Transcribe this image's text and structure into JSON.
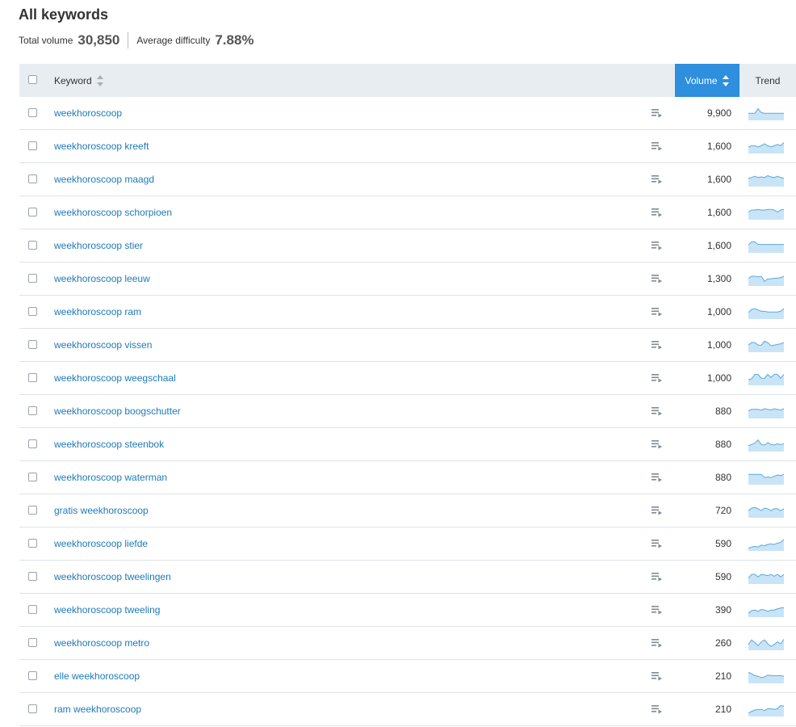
{
  "header": {
    "title": "All keywords",
    "total_volume_label": "Total volume",
    "total_volume_value": "30,850",
    "avg_difficulty_label": "Average difficulty",
    "avg_difficulty_value": "7.88%"
  },
  "table": {
    "columns": {
      "keyword": "Keyword",
      "volume": "Volume",
      "trend": "Trend"
    },
    "sort_column": "Volume",
    "accent_color": "#2d8fdd",
    "rows": [
      {
        "keyword": "weekhoroscoop",
        "volume": "9,900",
        "trend": [
          0.55,
          0.55,
          0.55,
          0.9,
          0.6,
          0.55,
          0.55,
          0.55,
          0.55,
          0.55,
          0.55,
          0.55
        ]
      },
      {
        "keyword": "weekhoroscoop kreeft",
        "volume": "1,600",
        "trend": [
          0.5,
          0.6,
          0.6,
          0.5,
          0.6,
          0.75,
          0.6,
          0.5,
          0.6,
          0.7,
          0.6,
          0.85
        ]
      },
      {
        "keyword": "weekhoroscoop maagd",
        "volume": "1,600",
        "trend": [
          0.65,
          0.7,
          0.8,
          0.7,
          0.75,
          0.7,
          0.85,
          0.75,
          0.7,
          0.8,
          0.7,
          0.65
        ]
      },
      {
        "keyword": "weekhoroscoop schorpioen",
        "volume": "1,600",
        "trend": [
          0.6,
          0.75,
          0.75,
          0.8,
          0.75,
          0.75,
          0.8,
          0.8,
          0.75,
          0.6,
          0.75,
          0.8
        ]
      },
      {
        "keyword": "weekhoroscoop stier",
        "volume": "1,600",
        "trend": [
          0.6,
          0.85,
          0.85,
          0.65,
          0.65,
          0.65,
          0.65,
          0.65,
          0.65,
          0.65,
          0.65,
          0.65
        ]
      },
      {
        "keyword": "weekhoroscoop leeuw",
        "volume": "1,300",
        "trend": [
          0.6,
          0.75,
          0.75,
          0.7,
          0.75,
          0.35,
          0.55,
          0.55,
          0.6,
          0.6,
          0.65,
          0.75
        ]
      },
      {
        "keyword": "weekhoroscoop ram",
        "volume": "1,000",
        "trend": [
          0.5,
          0.75,
          0.8,
          0.7,
          0.6,
          0.6,
          0.55,
          0.55,
          0.55,
          0.55,
          0.6,
          0.8
        ]
      },
      {
        "keyword": "weekhoroscoop vissen",
        "volume": "1,000",
        "trend": [
          0.55,
          0.75,
          0.75,
          0.55,
          0.55,
          0.85,
          0.75,
          0.5,
          0.55,
          0.6,
          0.65,
          0.75
        ]
      },
      {
        "keyword": "weekhoroscoop weegschaal",
        "volume": "1,000",
        "trend": [
          0.45,
          0.5,
          0.85,
          0.85,
          0.55,
          0.55,
          0.85,
          0.6,
          0.85,
          0.85,
          0.55,
          0.85
        ]
      },
      {
        "keyword": "weekhoroscoop boogschutter",
        "volume": "880",
        "trend": [
          0.6,
          0.7,
          0.7,
          0.7,
          0.65,
          0.75,
          0.7,
          0.65,
          0.75,
          0.7,
          0.65,
          0.75
        ]
      },
      {
        "keyword": "weekhoroscoop steenbok",
        "volume": "880",
        "trend": [
          0.45,
          0.55,
          0.65,
          0.9,
          0.55,
          0.5,
          0.7,
          0.55,
          0.5,
          0.6,
          0.55,
          0.6
        ]
      },
      {
        "keyword": "weekhoroscoop waterman",
        "volume": "880",
        "trend": [
          0.8,
          0.8,
          0.8,
          0.8,
          0.8,
          0.55,
          0.6,
          0.55,
          0.65,
          0.75,
          0.7,
          0.8
        ]
      },
      {
        "keyword": "gratis weekhoroscoop",
        "volume": "720",
        "trend": [
          0.55,
          0.75,
          0.8,
          0.7,
          0.55,
          0.75,
          0.7,
          0.55,
          0.7,
          0.7,
          0.55,
          0.7
        ]
      },
      {
        "keyword": "weekhoroscoop liefde",
        "volume": "590",
        "trend": [
          0.2,
          0.3,
          0.35,
          0.3,
          0.45,
          0.4,
          0.5,
          0.55,
          0.5,
          0.6,
          0.65,
          0.9
        ]
      },
      {
        "keyword": "weekhoroscoop tweelingen",
        "volume": "590",
        "trend": [
          0.45,
          0.75,
          0.75,
          0.55,
          0.75,
          0.7,
          0.65,
          0.75,
          0.6,
          0.75,
          0.55,
          0.75
        ]
      },
      {
        "keyword": "weekhoroscoop tweeling",
        "volume": "390",
        "trend": [
          0.3,
          0.5,
          0.55,
          0.45,
          0.6,
          0.55,
          0.45,
          0.55,
          0.55,
          0.65,
          0.7,
          0.75
        ]
      },
      {
        "keyword": "weekhoroscoop metro",
        "volume": "260",
        "trend": [
          0.45,
          0.8,
          0.6,
          0.35,
          0.65,
          0.8,
          0.5,
          0.3,
          0.45,
          0.65,
          0.5,
          0.85
        ]
      },
      {
        "keyword": "elle weekhoroscoop",
        "volume": "210",
        "trend": [
          0.85,
          0.75,
          0.6,
          0.55,
          0.45,
          0.5,
          0.65,
          0.6,
          0.6,
          0.6,
          0.6,
          0.55
        ]
      },
      {
        "keyword": "ram weekhoroscoop",
        "volume": "210",
        "trend": [
          0.25,
          0.4,
          0.5,
          0.55,
          0.55,
          0.45,
          0.6,
          0.6,
          0.55,
          0.6,
          0.85,
          0.8
        ]
      }
    ]
  }
}
